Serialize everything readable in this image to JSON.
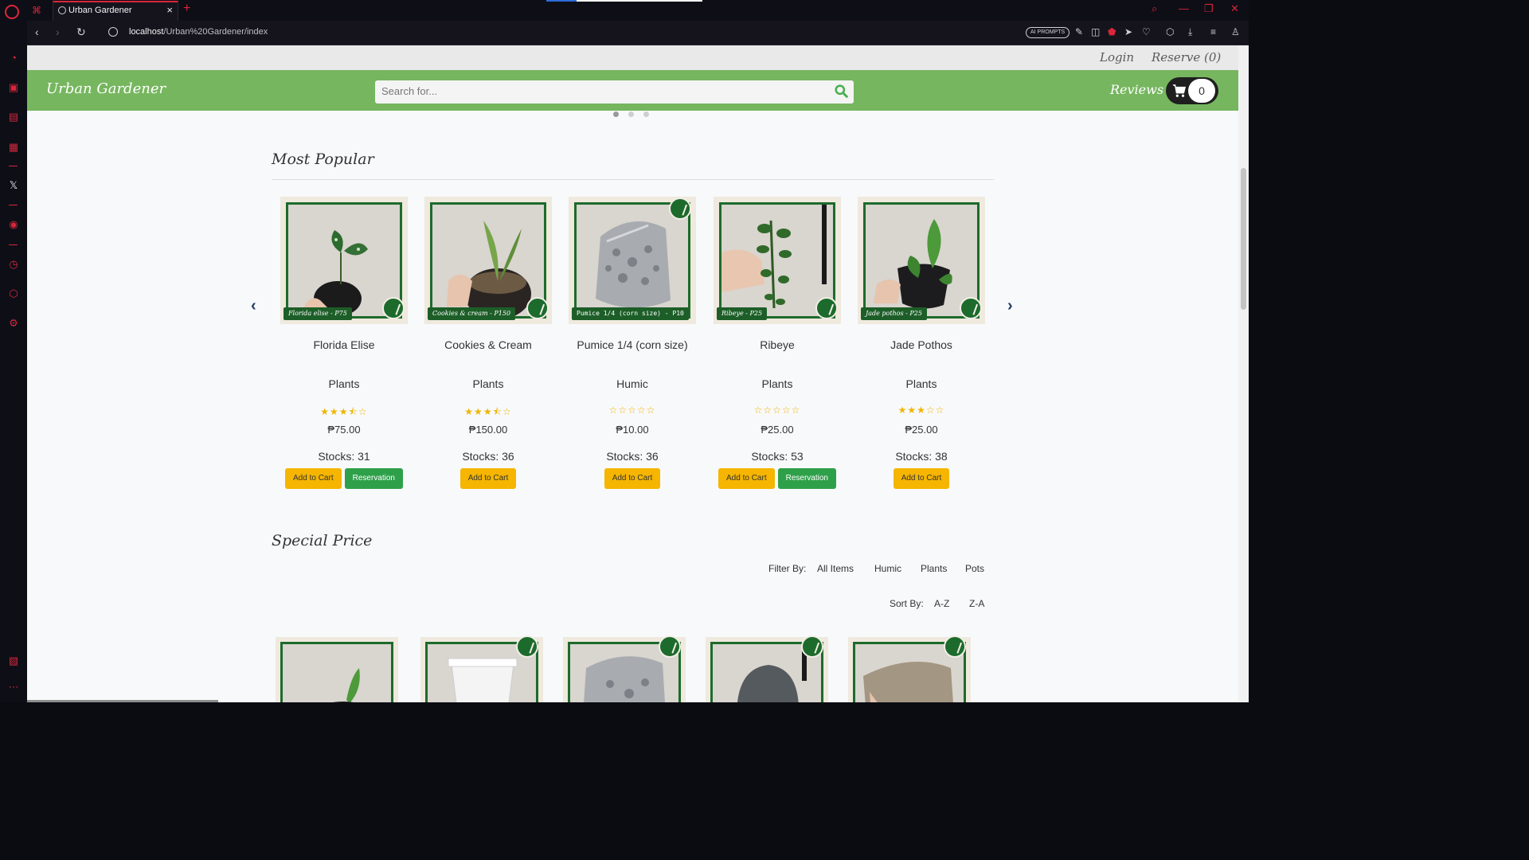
{
  "browser": {
    "tab_title": "Urban Gardener",
    "url_host": "localhost",
    "url_path": "/Urban%20Gardener/index",
    "ai_prompts_label": "AI PROMPTS",
    "new_tab_glyph": "+",
    "close_glyph": "×"
  },
  "topbar": {
    "login": "Login",
    "reserve": "Reserve (0)"
  },
  "navbar": {
    "brand": "Urban Gardener",
    "search_placeholder": "Search for...",
    "reviews": "Reviews",
    "cart_count": "0",
    "brand_color": "#76b65f"
  },
  "most_popular": {
    "title": "Most Popular",
    "prev_glyph": "‹",
    "next_glyph": "›",
    "products": [
      {
        "label": "Florida elise - P75",
        "name": "Florida Elise",
        "category": "Plants",
        "stars": "★★★⯪☆",
        "rating": 3.5,
        "price": "₱75.00",
        "stock": "Stocks: 31",
        "add_to_cart": "Add to Cart",
        "reservation": "Reservation"
      },
      {
        "label": "Cookies & cream - P150",
        "name": "Cookies & Cream",
        "category": "Plants",
        "stars": "★★★⯪☆",
        "rating": 3.5,
        "price": "₱150.00",
        "stock": "Stocks: 36",
        "add_to_cart": "Add to Cart"
      },
      {
        "label": "Pumice 1/4 (corn size) - P10",
        "name": "Pumice 1/4 (corn size)",
        "category": "Humic",
        "stars": "☆☆☆☆☆",
        "rating": 0,
        "price": "₱10.00",
        "stock": "Stocks: 36",
        "add_to_cart": "Add to Cart"
      },
      {
        "label": "Ribeye - P25",
        "name": "Ribeye",
        "category": "Plants",
        "stars": "☆☆☆☆☆",
        "rating": 0,
        "price": "₱25.00",
        "stock": "Stocks: 53",
        "add_to_cart": "Add to Cart",
        "reservation": "Reservation"
      },
      {
        "label": "Jade pothos - P25",
        "name": "Jade Pothos",
        "category": "Plants",
        "stars": "★★★☆☆",
        "rating": 3,
        "price": "₱25.00",
        "stock": "Stocks: 38",
        "add_to_cart": "Add to Cart"
      }
    ]
  },
  "special_price": {
    "title": "Special Price",
    "filter_label": "Filter By:",
    "filters": [
      "All Items",
      "Humic",
      "Plants",
      "Pots"
    ],
    "sort_label": "Sort By:",
    "sorts": [
      "A-Z",
      "Z-A"
    ]
  },
  "colors": {
    "accent_red": "#d9263b",
    "add_to_cart": "#f5b500",
    "reservation": "#2ea04a",
    "frame_green": "#1d6b2c"
  }
}
